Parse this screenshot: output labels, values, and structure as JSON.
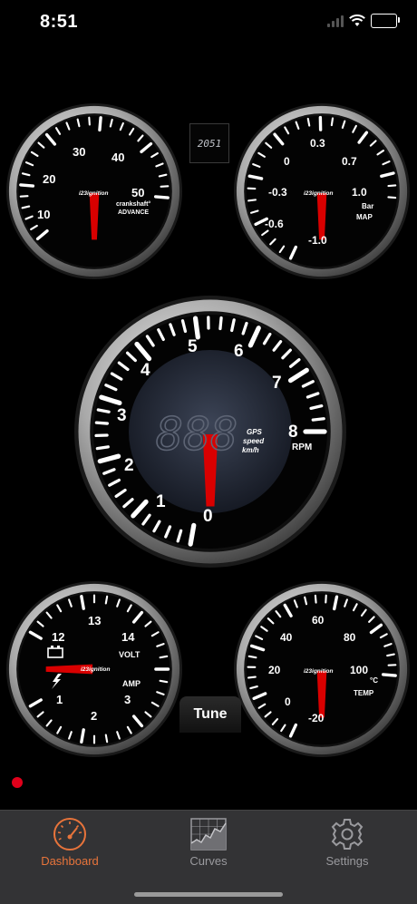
{
  "status": {
    "time": "8:51"
  },
  "small_display": {
    "value": "2051"
  },
  "gauges": {
    "advance": {
      "ticks": [
        "10",
        "20",
        "30",
        "40",
        "50"
      ],
      "brand": "i23ignition",
      "unit_line1": "crankshaft°",
      "unit_line2": "ADVANCE"
    },
    "map": {
      "ticks": [
        "-1.0",
        "-0.6",
        "-0.3",
        "0",
        "0.3",
        "0.7",
        "1.0"
      ],
      "brand": "i23ignition",
      "unit_line1": "Bar",
      "unit_line2": "MAP"
    },
    "rpm": {
      "ticks": [
        "0",
        "1",
        "2",
        "3",
        "4",
        "5",
        "6",
        "7",
        "8"
      ],
      "digits": "888",
      "speed_line1": "GPS",
      "speed_line2": "speed",
      "speed_line3": "km/h",
      "unit": "RPM"
    },
    "voltamp": {
      "volt_ticks": [
        "12",
        "13",
        "14"
      ],
      "amp_ticks": [
        "1",
        "2",
        "3"
      ],
      "brand": "i23ignition",
      "volt_label": "VOLT",
      "amp_label": "AMP"
    },
    "temp": {
      "ticks": [
        "-20",
        "0",
        "20",
        "40",
        "60",
        "80",
        "100"
      ],
      "brand": "i23ignition",
      "unit_line1": "°C",
      "unit_line2": "TEMP"
    }
  },
  "tune_button": {
    "label": "Tune"
  },
  "tabs": [
    {
      "label": "Dashboard",
      "icon": "speedometer-icon",
      "active": true
    },
    {
      "label": "Curves",
      "icon": "chart-icon",
      "active": false
    },
    {
      "label": "Settings",
      "icon": "gear-icon",
      "active": false
    }
  ],
  "colors": {
    "accent": "#e8743b",
    "needle": "#d90000",
    "inactive_tab": "#9a9a9e",
    "bezel": "#c9c9c9"
  }
}
